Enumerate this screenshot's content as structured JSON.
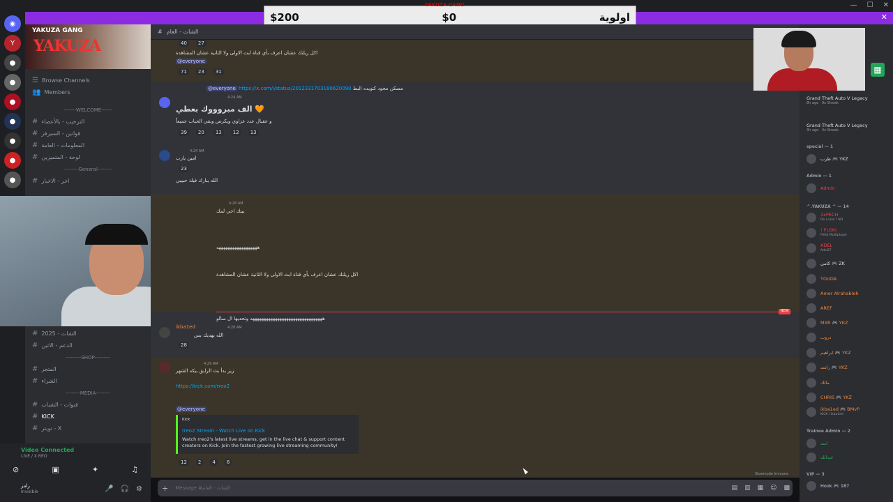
{
  "goal": {
    "left": "اولوية",
    "mid": "$0",
    "right": "$200",
    "tag": "YAKUZA GANG"
  },
  "sidebar": {
    "server_name": "YAKUZA GANG",
    "logo_text": "YAKUZA",
    "browse": "Browse Channels",
    "members": "Members",
    "cats": [
      "-------WELCOME------",
      "--------General--------",
      "---------SHOP---------",
      "--------MEDIA--------"
    ],
    "channels": [
      "الترحيب - بالأعضاء",
      "قوانين - السيرفر",
      "المعلومات - العامة",
      "لوحة - المتميزين",
      "اخر - الاخبار",
      "الشات - العام",
      "الشات - 2025",
      "الدعم - الاتين",
      "المتجر",
      "الشراء",
      "قنوات - الشباب",
      "KICK",
      "تويتر - X"
    ]
  },
  "voice": {
    "status": "Video Connected",
    "server": "LIVE / X REO",
    "user": "رامز",
    "user_status": "Invisible"
  },
  "header": {
    "channel": "الشات - العام"
  },
  "chat": {
    "m1_text": "اكل ريلتك عشان اعرف بأي قناة ابث الاولى ولا الثانية عشان المشاهدة",
    "m1_mention": "@everyone",
    "m1_rx": [
      "71",
      "23",
      "31"
    ],
    "m1_top": [
      "40",
      "27"
    ],
    "m2_head": "@everyone",
    "m2_link": "https://x.com/i/status/2012331703180620090",
    "m2_author": "مسكن مجود كتويده البط",
    "m2_time": "4:24 AM",
    "m2_big": "الف مبروووك بعطي 🧡",
    "m2_sub": "و عقبال عدد عزاوي ويكرس وبقي الحباب جميعاً",
    "m2_rx": [
      "39",
      "20",
      "13",
      "12",
      "13"
    ],
    "m3_time": "4:24 AM",
    "m3_text": "امين يارب",
    "m3_rx": [
      "23"
    ],
    "m3_sub": "الله يبارك فيك حبيبي",
    "m4_time": "4:28 AM",
    "m4_text": "بيتك احي لمك",
    "m5_text": "ههههههههههههههههههه",
    "m6_text": "اكل ريلتك عشان اعرف بأي قناة ابث الاولى ولا الثانية عشان المشاهدة",
    "m7_text": "ههههههههههههههههههههههههههههههههه وتحديها ال سالو",
    "m7_author": "ikba1ed",
    "m7_time": "4:28 AM",
    "m7_text2": "الله يهديك بس",
    "m7_rx": [
      "28"
    ],
    "new_tag": "NEW",
    "m8_time": "4:29 AM",
    "m8_text": "زيز بدأ بث الرايق بيكه الشهر",
    "m8_link": "https://kick.com/rreo2",
    "m8_mention": "@everyone",
    "embed_provider": "Kick",
    "embed_title": "rreo2 Stream - Watch Live on Kick",
    "embed_desc": "Watch rreo2's latest live streams, get in the live chat & support content creators on Kick. Join the fastest growing live streaming community!",
    "m8_rx": [
      "12",
      "2",
      "4",
      "6"
    ]
  },
  "composer": {
    "placeholder": "Message #الشات - العام"
  },
  "slowmode": "Slowmode Immune",
  "members": {
    "act1": "Grand Theft Auto V Legacy",
    "act1_sub": "8h ago · 9x Streak",
    "act2": "Grand Theft Auto V Legacy",
    "act2_sub": "3h ago · 3x Streak",
    "roles": [
      "special — 1",
      "Admin — 1",
      "ᄼ.YAKUZA ᄾ — 14",
      "Trainee Admin — 2",
      "VIP — 3"
    ],
    "names": [
      {
        "n": "طرب 🎮 YKZ",
        "s": "",
        "c": "#dbdee1"
      },
      {
        "n": "Admin",
        "s": "",
        "c": "#f23f43"
      },
      {
        "n": "1xPECH",
        "s": "Do I care ? NO",
        "c": "#f23f43"
      },
      {
        "n": "! FLOKI",
        "s": "FAGE Multiplayer",
        "c": "#f23f43"
      },
      {
        "n": "ADEL",
        "s": "Adel27",
        "c": "#f23f43"
      },
      {
        "n": "كامي 🎮 ZK",
        "s": "",
        "c": "#dbdee1"
      },
      {
        "n": "TOUDA",
        "s": "",
        "c": "#f0883e"
      },
      {
        "n": "Amer Alrahableh",
        "s": "",
        "c": "#f0883e"
      },
      {
        "n": "AREF",
        "s": "",
        "c": "#f0883e"
      },
      {
        "n": "MXR 🎮 YKZ",
        "s": "",
        "c": "#f0883e"
      },
      {
        "n": "دروب",
        "s": "",
        "c": "#f0883e"
      },
      {
        "n": "ابراهيم 🎮 YKZ",
        "s": "",
        "c": "#f0883e"
      },
      {
        "n": "راشد 🎮 YKZ",
        "s": "",
        "c": "#f0883e"
      },
      {
        "n": "مالك",
        "s": "",
        "c": "#f0883e"
      },
      {
        "n": "CHRIS 🎮 YKZ",
        "s": "",
        "c": "#f0883e"
      },
      {
        "n": "ikba1ed 🎮 BMvP",
        "s": "KICK / ikba1ed",
        "c": "#f0883e"
      },
      {
        "n": "اسد",
        "s": "",
        "c": "#23a55a"
      },
      {
        "n": "عبدالله",
        "s": "",
        "c": "#23a55a"
      },
      {
        "n": "Hook 🎮 187",
        "s": "",
        "c": "#c9cdfb"
      }
    ]
  }
}
